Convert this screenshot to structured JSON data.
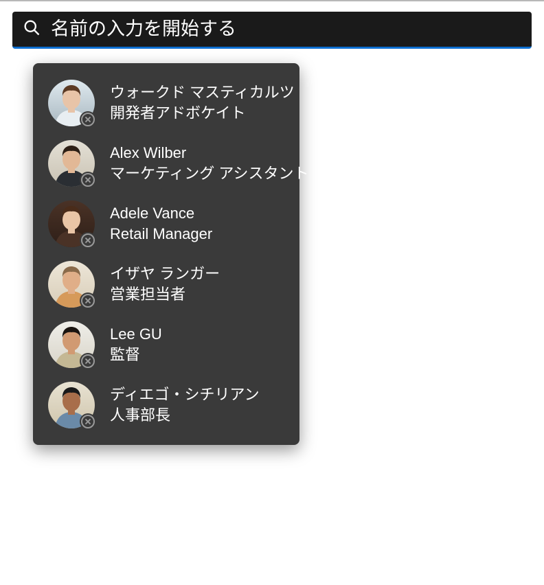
{
  "search": {
    "placeholder": "名前の入力を開始する",
    "value": ""
  },
  "dropdown": {
    "people": [
      {
        "name": "ウォークド マスティカルツ",
        "role": "開発者アドボケイト",
        "avatar_bg_top": "#dfe9ef",
        "avatar_bg_bottom": "#a9b8c0",
        "hair": "#5b3a24",
        "skin": "#e8c4a8",
        "shirt": "#e8eef2"
      },
      {
        "name": "Alex Wilber",
        "role": "マーケティング アシスタント",
        "avatar_bg_top": "#e4e0d6",
        "avatar_bg_bottom": "#c9c2b2",
        "hair": "#2d1f15",
        "skin": "#e2b896",
        "shirt": "#2a2e33"
      },
      {
        "name": "Adele Vance",
        "role": "Retail Manager",
        "avatar_bg_top": "#4a3226",
        "avatar_bg_bottom": "#2e1f18",
        "hair": "#4a2c1a",
        "skin": "#e9c5a6",
        "shirt": "#4a3226"
      },
      {
        "name": "イザヤ ランガー",
        "role": "営業担当者",
        "avatar_bg_top": "#ede6d8",
        "avatar_bg_bottom": "#d8cdb8",
        "hair": "#8a6a4a",
        "skin": "#e0ae88",
        "shirt": "#d69a5a"
      },
      {
        "name": "Lee GU",
        "role": "監督",
        "avatar_bg_top": "#efeee9",
        "avatar_bg_bottom": "#d8d4c8",
        "hair": "#1a1410",
        "skin": "#d19a72",
        "shirt": "#c4b894"
      },
      {
        "name": "ディエゴ・シチリアン",
        "role": "人事部長",
        "avatar_bg_top": "#e8e2d2",
        "avatar_bg_bottom": "#cfc5ac",
        "hair": "#1a1a1a",
        "skin": "#a86e4a",
        "shirt": "#6a8aa8"
      }
    ]
  }
}
